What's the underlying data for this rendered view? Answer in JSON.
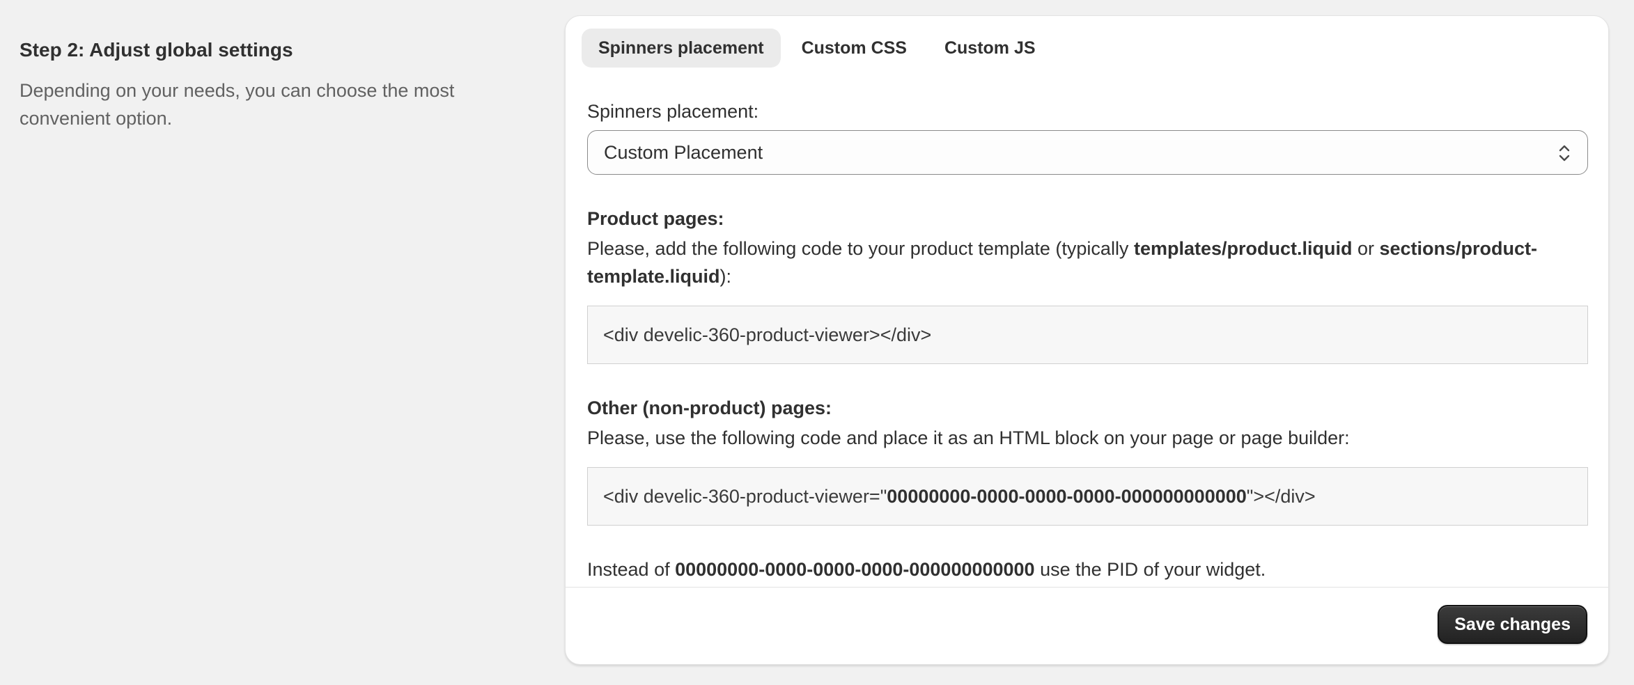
{
  "step": {
    "title": "Step 2: Adjust global settings",
    "description": "Depending on your needs, you can choose the most convenient option."
  },
  "tabs": [
    {
      "label": "Spinners placement",
      "active": true
    },
    {
      "label": "Custom CSS",
      "active": false
    },
    {
      "label": "Custom JS",
      "active": false
    }
  ],
  "placement": {
    "label": "Spinners placement:",
    "selected": "Custom Placement"
  },
  "product_pages": {
    "title": "Product pages:",
    "text_before": "Please, add the following code to your product template (typically ",
    "file1": "templates/product.liquid",
    "text_or": " or ",
    "file2": "sections/product-template.liquid",
    "text_after": "):",
    "code": "<div develic-360-product-viewer></div>"
  },
  "other_pages": {
    "title": "Other (non-product) pages:",
    "text": "Please, use the following code and place it as an HTML block on your page or page builder:",
    "code_before": "<div develic-360-product-viewer=\"",
    "code_pid": "00000000-0000-0000-0000-000000000000",
    "code_after": "\"></div>"
  },
  "note": {
    "before": "Instead of ",
    "pid": "00000000-0000-0000-0000-000000000000",
    "after": " use the PID of your widget."
  },
  "actions": {
    "save_label": "Save changes"
  }
}
